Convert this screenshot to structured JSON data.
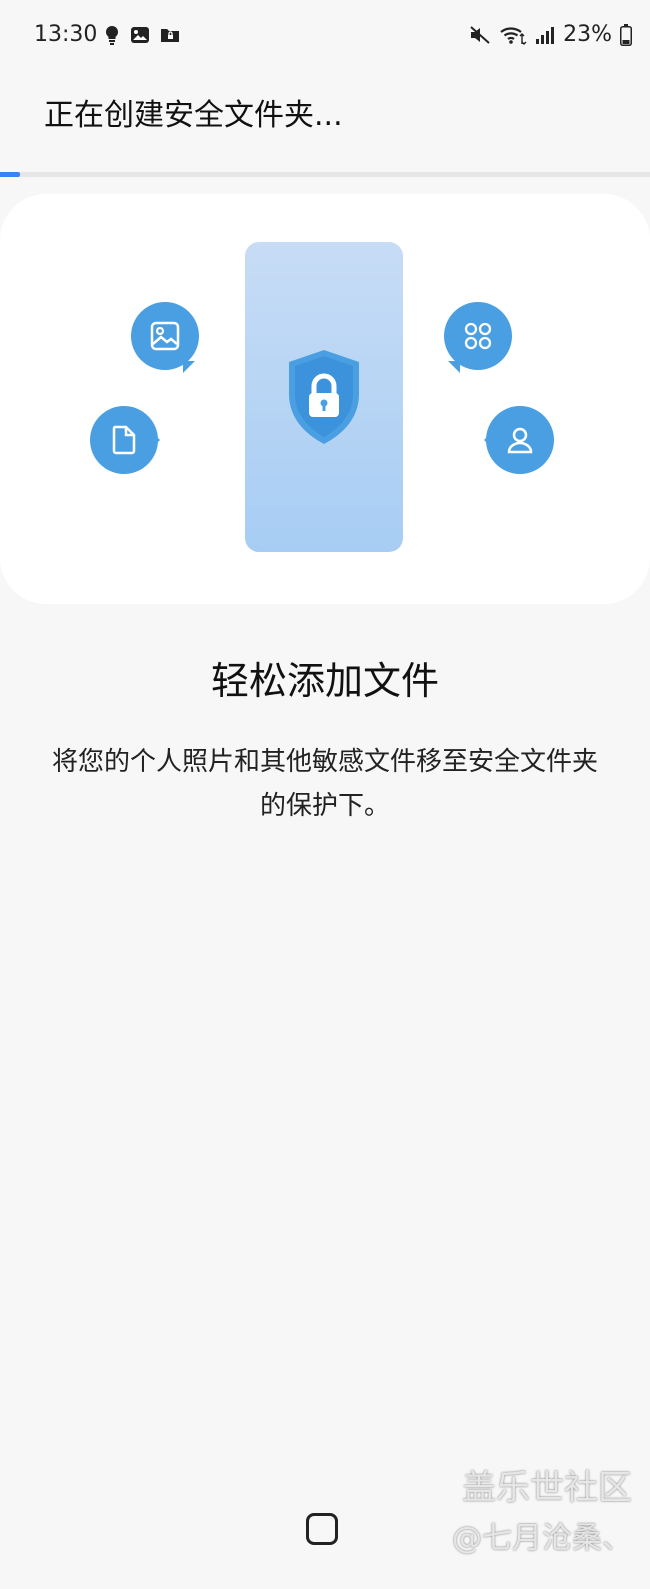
{
  "status_bar": {
    "time": "13:30",
    "battery": "23%",
    "left_icons": [
      "bulb-icon",
      "image-icon",
      "folder-lock-icon"
    ],
    "right_icons": [
      "mute-icon",
      "wifi-icon",
      "signal-icon",
      "battery-icon"
    ]
  },
  "header": {
    "title": "正在创建安全文件夹..."
  },
  "progress": {
    "value": 0.03,
    "accent_color": "#3b82f6"
  },
  "hero": {
    "bubbles": [
      "image-icon",
      "document-icon",
      "apps-icon",
      "user-icon"
    ],
    "center_icon": "shield-lock-icon",
    "accent_color": "#4a9fe3"
  },
  "content": {
    "title": "轻松添加文件",
    "description": "将您的个人照片和其他敏感文件移至安全文件夹的保护下。"
  },
  "watermark": {
    "line1": "盖乐世社区",
    "line2": "@七月沧桑、"
  },
  "nav": {
    "home": "home-button"
  }
}
